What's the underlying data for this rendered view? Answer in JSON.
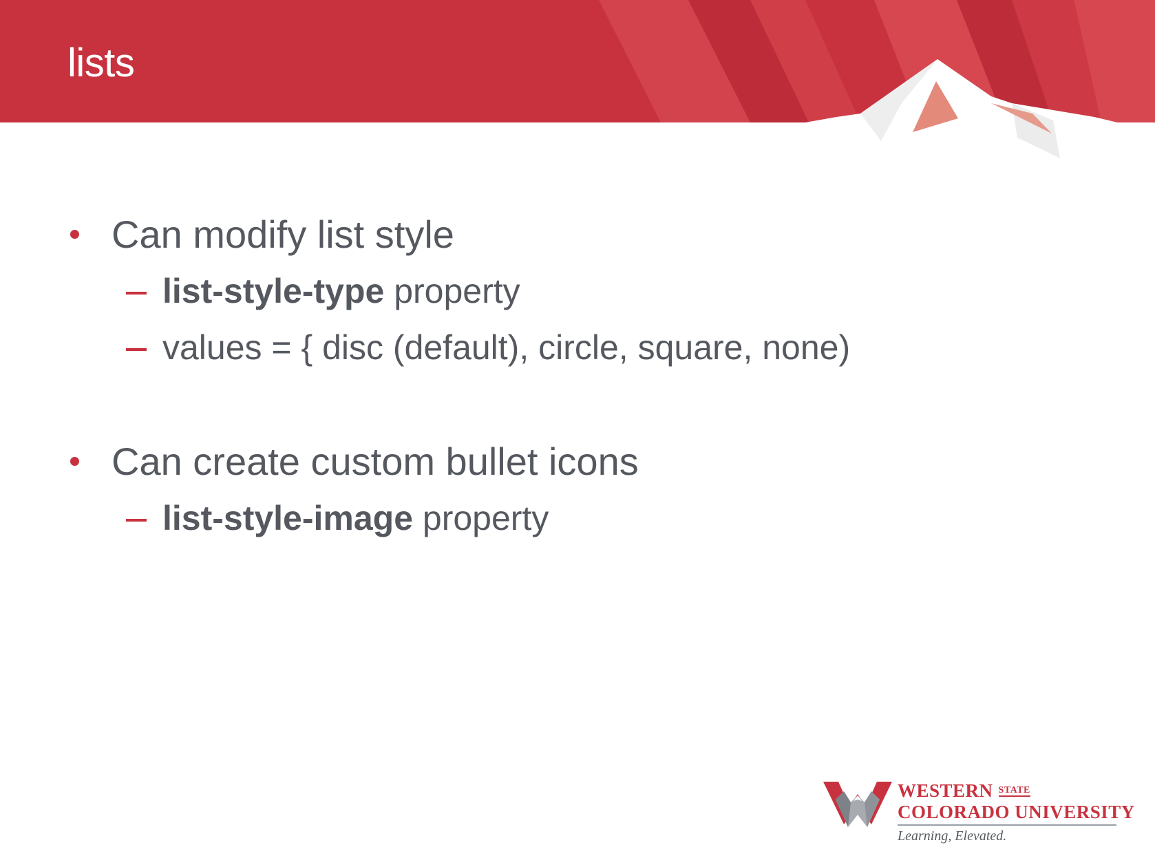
{
  "slide": {
    "title": "lists",
    "bullets": [
      {
        "text": "Can modify list style",
        "sub": [
          {
            "bold": "list-style-type",
            "text": " property"
          },
          {
            "bold": "",
            "text": "values = { disc (default), circle, square, none)"
          }
        ]
      },
      {
        "text": "Can create custom bullet icons",
        "sub": [
          {
            "bold": "list-style-image",
            "text": " property"
          }
        ]
      }
    ]
  },
  "logo": {
    "name_line1": "WESTERN",
    "name_state": "STATE",
    "name_line2": "COLORADO UNIVERSITY",
    "tagline": "Learning, Elevated."
  },
  "colors": {
    "banner_red": "#c8323f",
    "accent_red": "#c8323f",
    "text_gray": "#55595f"
  }
}
